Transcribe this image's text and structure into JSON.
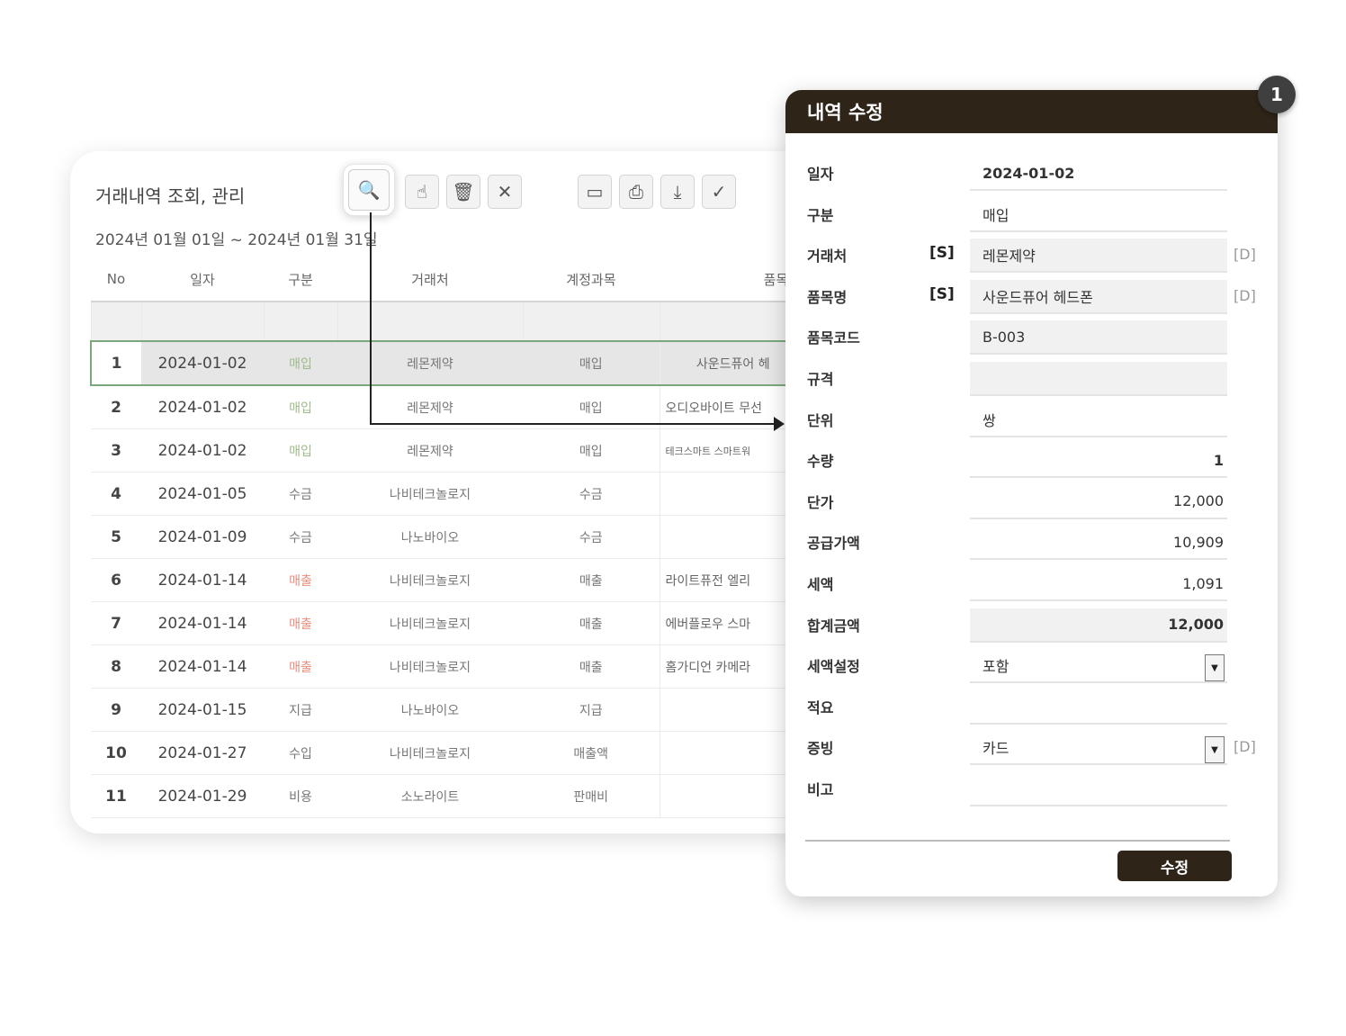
{
  "list": {
    "title": "거래내역 조회, 관리",
    "period": "2024년 01월 01일 ~ 2024년 01월 31일",
    "toolbar": [
      {
        "name": "search-icon",
        "glyph": "🔍"
      },
      {
        "name": "pointer-icon",
        "glyph": "☝"
      },
      {
        "name": "trash-icon",
        "glyph": "🗑"
      },
      {
        "name": "close-icon",
        "glyph": "✕"
      },
      {
        "name": "monitor-icon",
        "glyph": "▭"
      },
      {
        "name": "print-icon",
        "glyph": "⎙"
      },
      {
        "name": "download-icon",
        "glyph": "⤓"
      },
      {
        "name": "check-icon",
        "glyph": "✓"
      }
    ],
    "columns": [
      "No",
      "일자",
      "구분",
      "거래처",
      "계정과목",
      "품목명"
    ],
    "rows": [
      {
        "no": "1",
        "date": "2024-01-02",
        "type": "매입",
        "tone": "buy",
        "client": "레몬제약",
        "account": "매입",
        "product": "사운드퓨어 헤",
        "selected": true
      },
      {
        "no": "2",
        "date": "2024-01-02",
        "type": "매입",
        "tone": "buy",
        "client": "레몬제약",
        "account": "매입",
        "product": "오디오바이트 무선"
      },
      {
        "no": "3",
        "date": "2024-01-02",
        "type": "매입",
        "tone": "buy",
        "client": "레몬제약",
        "account": "매입",
        "product": "테크스마트 스마트워"
      },
      {
        "no": "4",
        "date": "2024-01-05",
        "type": "수금",
        "tone": "",
        "client": "나비테크놀로지",
        "account": "수금",
        "product": ""
      },
      {
        "no": "5",
        "date": "2024-01-09",
        "type": "수금",
        "tone": "",
        "client": "나노바이오",
        "account": "수금",
        "product": ""
      },
      {
        "no": "6",
        "date": "2024-01-14",
        "type": "매출",
        "tone": "sell",
        "client": "나비테크놀로지",
        "account": "매출",
        "product": "라이트퓨전 엘리"
      },
      {
        "no": "7",
        "date": "2024-01-14",
        "type": "매출",
        "tone": "sell",
        "client": "나비테크놀로지",
        "account": "매출",
        "product": "에버플로우 스마"
      },
      {
        "no": "8",
        "date": "2024-01-14",
        "type": "매출",
        "tone": "sell",
        "client": "나비테크놀로지",
        "account": "매출",
        "product": "홈가디언 카메라"
      },
      {
        "no": "9",
        "date": "2024-01-15",
        "type": "지급",
        "tone": "",
        "client": "나노바이오",
        "account": "지급",
        "product": ""
      },
      {
        "no": "10",
        "date": "2024-01-27",
        "type": "수입",
        "tone": "",
        "client": "나비테크놀로지",
        "account": "매출액",
        "product": ""
      },
      {
        "no": "11",
        "date": "2024-01-29",
        "type": "비용",
        "tone": "",
        "client": "소노라이트",
        "account": "판매비",
        "product": ""
      }
    ]
  },
  "dialog": {
    "title": "내역 수정",
    "badge": "1",
    "fields": [
      {
        "label": "일자",
        "value": "2024-01-02",
        "bold": true
      },
      {
        "label": "구분",
        "value": "매입"
      },
      {
        "label": "거래처",
        "tag": "[S]",
        "value": "레몬제약",
        "shade": true,
        "side": "[D]"
      },
      {
        "label": "품목명",
        "tag": "[S]",
        "value": "사운드퓨어 헤드폰",
        "shade": true,
        "side": "[D]"
      },
      {
        "label": "품목코드",
        "value": "B-003",
        "shade": true
      },
      {
        "label": "규격",
        "value": "",
        "shade": true
      },
      {
        "label": "단위",
        "value": "쌍"
      },
      {
        "label": "수량",
        "value": "1",
        "right": true,
        "bold": true
      },
      {
        "label": "단가",
        "value": "12,000",
        "right": true
      },
      {
        "label": "공급가액",
        "value": "10,909",
        "right": true
      },
      {
        "label": "세액",
        "value": "1,091",
        "right": true
      },
      {
        "label": "합계금액",
        "value": "12,000",
        "right": true,
        "bold": true,
        "shade": true
      },
      {
        "label": "세액설정",
        "value": "포함",
        "dropdown": true
      },
      {
        "label": "적요",
        "value": ""
      },
      {
        "label": "증빙",
        "value": "카드",
        "dropdown": true,
        "side": "[D]"
      },
      {
        "label": "비고",
        "value": ""
      }
    ],
    "submit_label": "수정"
  }
}
